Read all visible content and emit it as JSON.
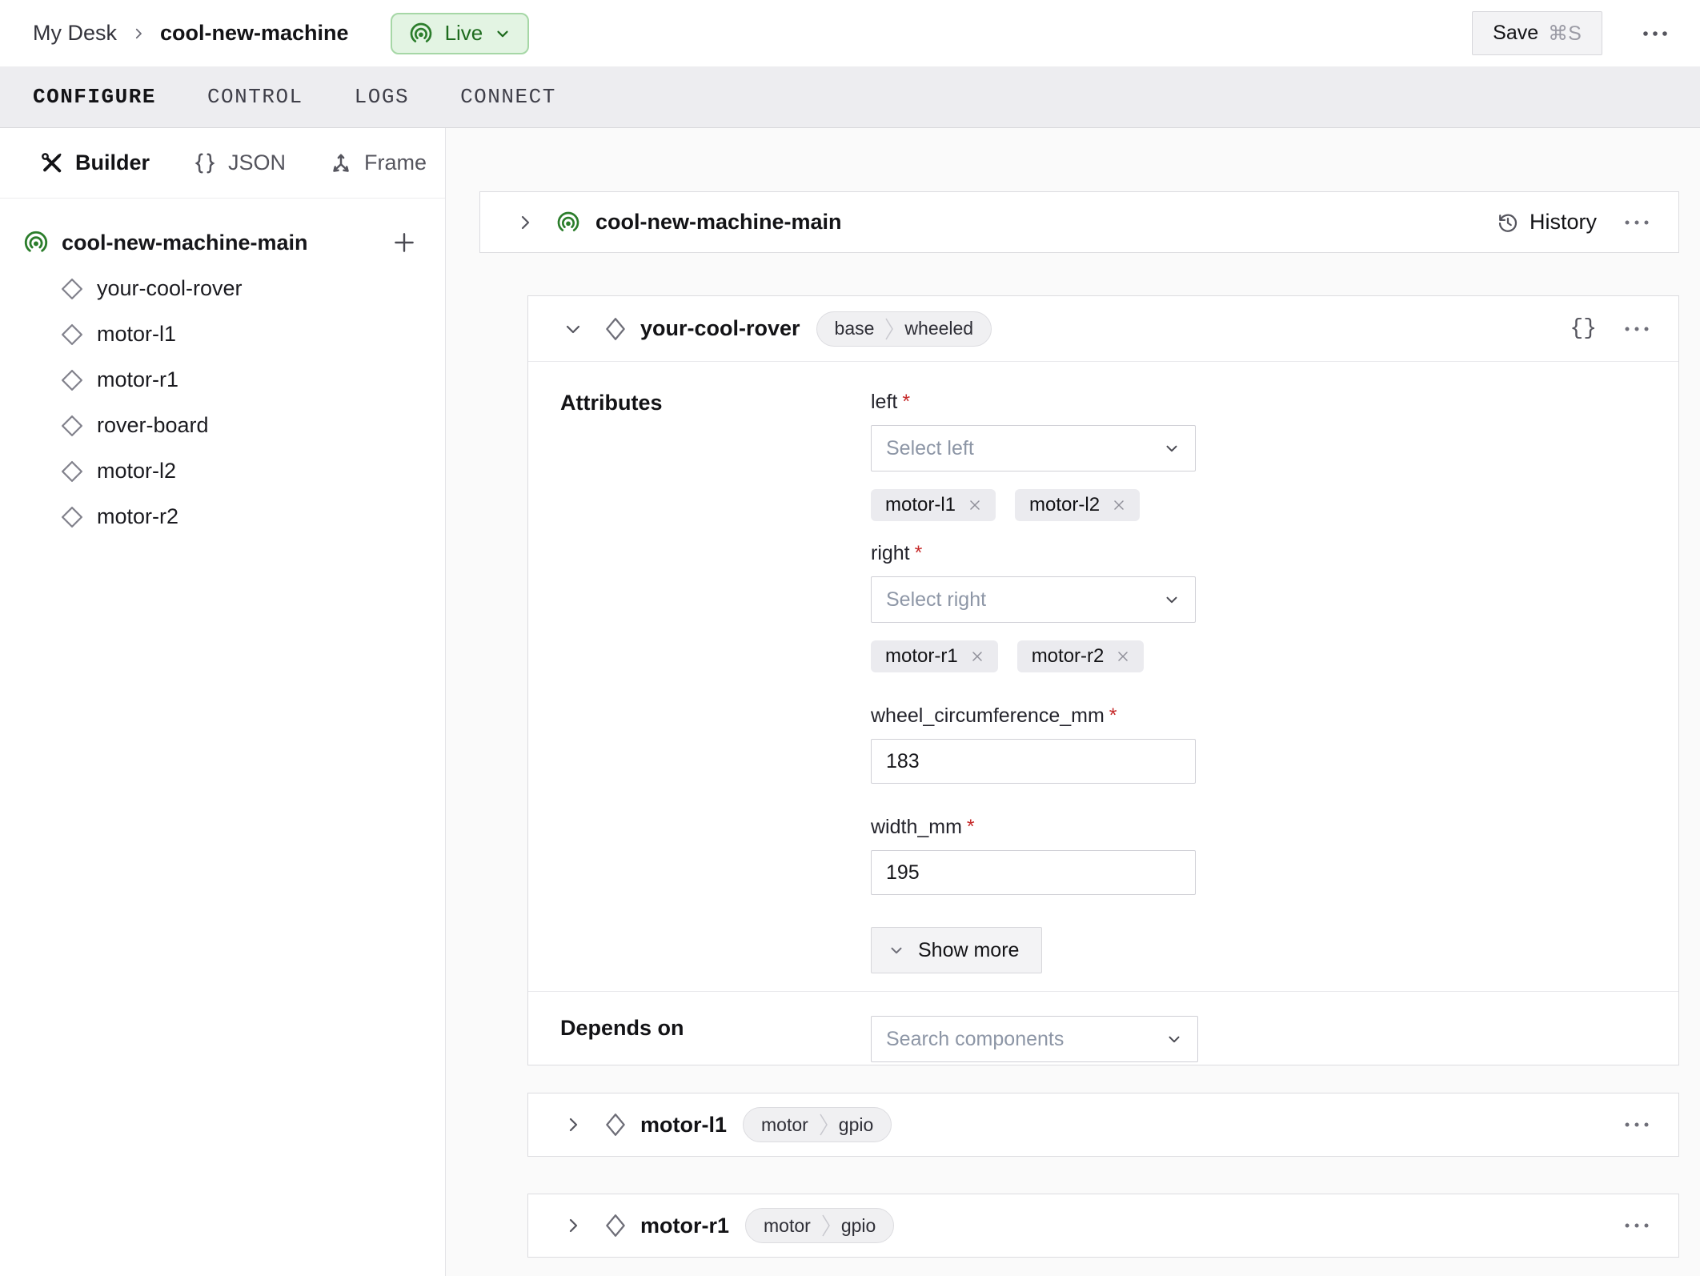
{
  "topbar": {
    "breadcrumb": {
      "root": "My Desk",
      "current": "cool-new-machine"
    },
    "live_badge": {
      "label": "Live"
    },
    "save_button": {
      "label": "Save",
      "shortcut": "⌘S"
    }
  },
  "tabs": {
    "configure": "CONFIGURE",
    "control": "CONTROL",
    "logs": "LOGS",
    "connect": "CONNECT"
  },
  "sidebar": {
    "views": {
      "builder": "Builder",
      "json": "JSON",
      "frame": "Frame"
    },
    "tree": {
      "root": "cool-new-machine-main",
      "children": [
        "your-cool-rover",
        "motor-l1",
        "motor-r1",
        "rover-board",
        "motor-l2",
        "motor-r2"
      ]
    }
  },
  "main": {
    "machine_card": {
      "title": "cool-new-machine-main",
      "history": "History"
    },
    "rover_card": {
      "title": "your-cool-rover",
      "badges": [
        "base",
        "wheeled"
      ],
      "sections": {
        "attributes": "Attributes",
        "depends_on": "Depends on"
      },
      "fields": {
        "left": {
          "label": "left",
          "placeholder": "Select left",
          "chips": [
            "motor-l1",
            "motor-l2"
          ]
        },
        "right": {
          "label": "right",
          "placeholder": "Select right",
          "chips": [
            "motor-r1",
            "motor-r2"
          ]
        },
        "wheel_circumference_mm": {
          "label": "wheel_circumference_mm",
          "value": "183"
        },
        "width_mm": {
          "label": "width_mm",
          "value": "195"
        }
      },
      "show_more": "Show more",
      "depends_placeholder": "Search components"
    },
    "motor_l1_card": {
      "title": "motor-l1",
      "badges": [
        "motor",
        "gpio"
      ]
    },
    "motor_r1_card": {
      "title": "motor-r1",
      "badges": [
        "motor",
        "gpio"
      ]
    }
  },
  "colors": {
    "accent_green": "#2b7d2b",
    "live_bg": "#e3f4e3",
    "live_border": "#a6d7a6",
    "required_red": "#c62a2a"
  }
}
